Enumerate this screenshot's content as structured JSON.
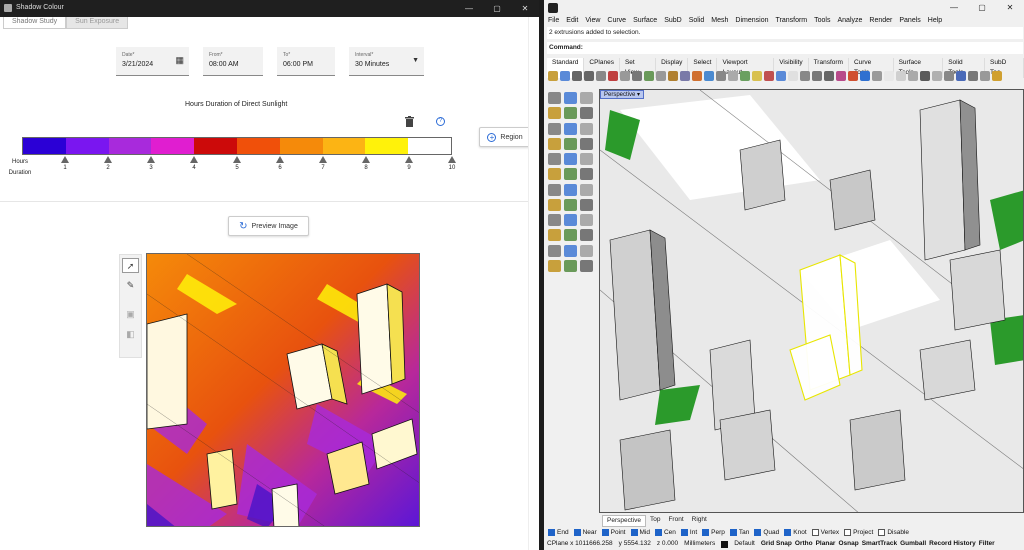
{
  "left_window": {
    "title": "Shadow Colour",
    "tabs": [
      "Shadow Study",
      "Sun Exposure"
    ],
    "date": {
      "label": "Date*",
      "value": "3/21/2024"
    },
    "from": {
      "label": "From*",
      "value": "08:00 AM"
    },
    "to": {
      "label": "To*",
      "value": "06:00 PM"
    },
    "interval": {
      "label": "Interval*",
      "value": "30 Minutes"
    },
    "chart_title": "Hours Duration of Direct Sunlight",
    "scale_colors": [
      "#2b00d6",
      "#7a16f0",
      "#a82adc",
      "#e01ed0",
      "#cc0a0a",
      "#f0500a",
      "#f58a0a",
      "#fcb414",
      "#fff20a",
      "#ffffff"
    ],
    "scale_ticks": [
      "1",
      "2",
      "3",
      "4",
      "5",
      "6",
      "7",
      "8",
      "9",
      "10"
    ],
    "scale_axis_label": "Hours Duration",
    "region_button": "Region",
    "preview_button": "Preview Image"
  },
  "right_window": {
    "menu": [
      "File",
      "Edit",
      "View",
      "Curve",
      "Surface",
      "SubD",
      "Solid",
      "Mesh",
      "Dimension",
      "Transform",
      "Tools",
      "Analyze",
      "Render",
      "Panels",
      "Help"
    ],
    "command_history": "2 extrusions added to selection.",
    "command_prompt": "Command:",
    "toolbar_tabs": [
      "Standard",
      "CPlanes",
      "Set View",
      "Display",
      "Select",
      "Viewport Layout",
      "Visibility",
      "Transform",
      "Curve Tools",
      "Surface Tools",
      "Solid Tools",
      "SubD Too"
    ],
    "viewport_label": "Perspective",
    "viewport_tabs": [
      "Perspective",
      "Top",
      "Front",
      "Right"
    ],
    "osnaps": [
      {
        "label": "End",
        "on": true
      },
      {
        "label": "Near",
        "on": true
      },
      {
        "label": "Point",
        "on": true
      },
      {
        "label": "Mid",
        "on": true
      },
      {
        "label": "Cen",
        "on": true
      },
      {
        "label": "Int",
        "on": true
      },
      {
        "label": "Perp",
        "on": true
      },
      {
        "label": "Tan",
        "on": true
      },
      {
        "label": "Quad",
        "on": true
      },
      {
        "label": "Knot",
        "on": true
      },
      {
        "label": "Vertex",
        "on": false
      },
      {
        "label": "Project",
        "on": false
      },
      {
        "label": "Disable",
        "on": false
      }
    ],
    "status": {
      "cplane": "CPlane x 1011666.258",
      "y": "y 5554.132",
      "z": "z 0.000",
      "units": "Millimeters",
      "layer": "Default",
      "toggles": [
        "Grid Snap",
        "Ortho",
        "Planar",
        "Osnap",
        "SmartTrack",
        "Gumball",
        "Record History",
        "Filter"
      ]
    }
  },
  "colors": {
    "accent": "#1e63c8",
    "selection": "#e8e600",
    "viewport_label": "#b9c7ef"
  }
}
